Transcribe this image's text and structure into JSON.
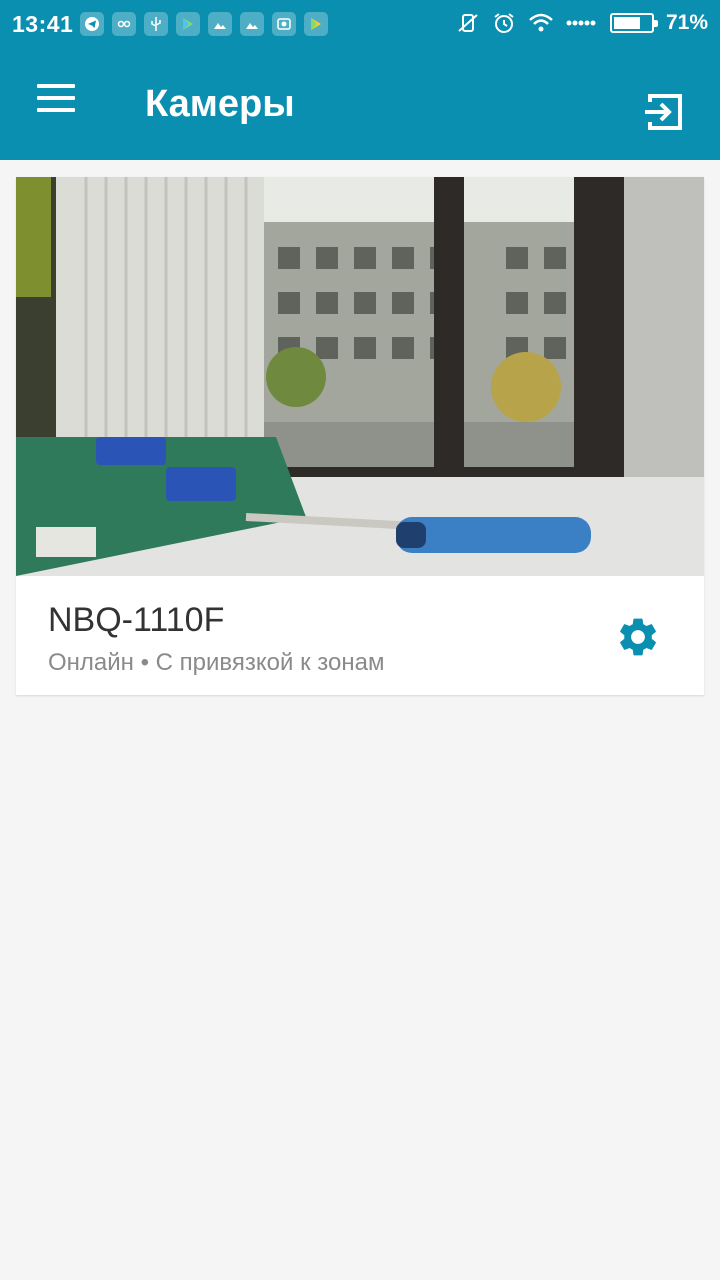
{
  "status_bar": {
    "time": "13:41",
    "battery_percent_text": "71%",
    "battery_level": 0.71,
    "notification_icons": [
      "telegram-icon",
      "share-icon",
      "usb-icon",
      "play-store-icon",
      "photos-icon",
      "photos-icon",
      "weather-icon",
      "play-store-icon"
    ],
    "system_icons": [
      "vibrate-off-icon",
      "alarm-icon",
      "wifi-icon",
      "signal-icon"
    ]
  },
  "app_bar": {
    "title": "Камеры",
    "menu_icon": "menu-icon",
    "exit_icon": "exit-to-app-icon",
    "color": "#0a8fb0"
  },
  "cameras": [
    {
      "name": "NBQ-1110F",
      "status": "Онлайн • С привязкой к зонам",
      "settings_icon": "gear-icon"
    }
  ],
  "colors": {
    "accent": "#0a8fb0",
    "background": "#f5f5f5",
    "text_primary": "#333333",
    "text_secondary": "#8a8a8a"
  }
}
